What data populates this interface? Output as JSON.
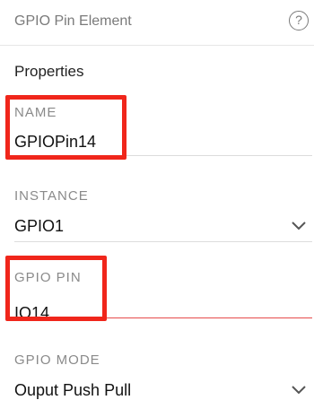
{
  "header": {
    "title": "GPIO Pin Element",
    "help_icon": "?"
  },
  "section": {
    "title": "Properties"
  },
  "fields": {
    "name": {
      "label": "NAME",
      "value": "GPIOPin14"
    },
    "instance": {
      "label": "INSTANCE",
      "value": "GPIO1",
      "icon": "chevron-down-icon"
    },
    "gpio_pin": {
      "label": "GPIO PIN",
      "value": "IO14"
    },
    "gpio_mode": {
      "label": "GPIO MODE",
      "value": "Ouput Push Pull",
      "icon": "chevron-down-icon"
    }
  },
  "colors": {
    "highlight": "#f0261b",
    "error_underline": "#e64b4b",
    "label": "#8a8a8a"
  }
}
